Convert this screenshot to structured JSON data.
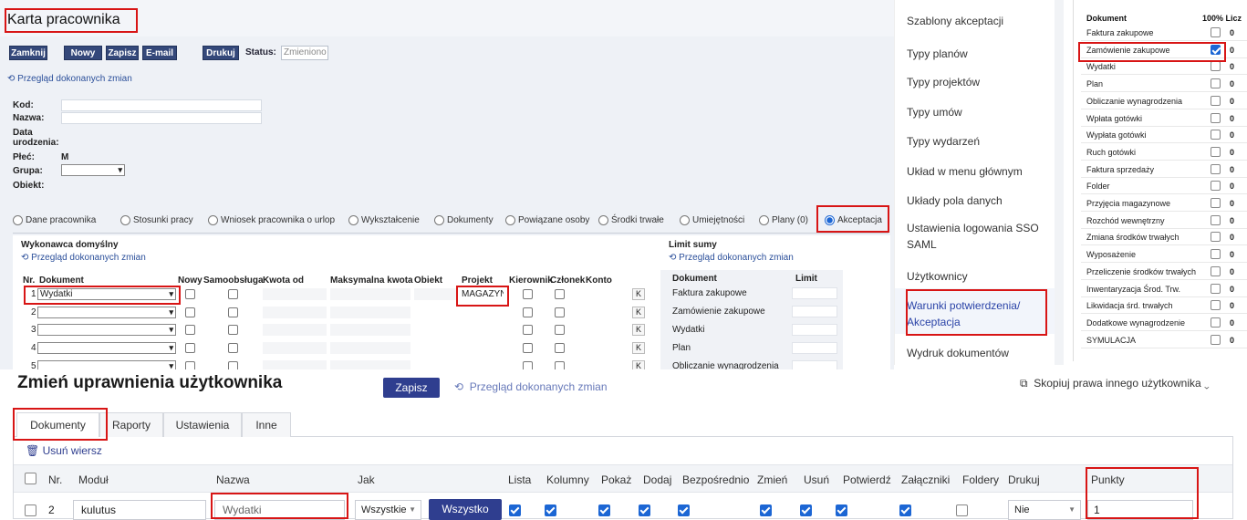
{
  "panel_a": {
    "title": "Karta pracownika",
    "toolbar": {
      "close": "Zamknij",
      "new": "Nowy",
      "save": "Zapisz",
      "email": "E-mail",
      "print": "Drukuj",
      "status_label": "Status:",
      "status_value": "Zmieniono"
    },
    "history_link": "Przegląd dokonanych zmian",
    "fields": {
      "code": "Kod:",
      "name": "Nazwa:",
      "dob_1": "Data",
      "dob_2": "urodzenia:",
      "sex": "Płeć:",
      "sex_value": "M",
      "group": "Grupa:",
      "object": "Obiekt:"
    },
    "tabs": [
      "Dane pracownika",
      "Stosunki pracy",
      "Wniosek pracownika o urlop",
      "Wykształcenie",
      "Dokumenty",
      "Powiązane osoby",
      "Środki trwałe",
      "Umiejętności",
      "Plany (0)",
      "Akceptacja"
    ],
    "section": {
      "title": "Wykonawca domyślny",
      "history_link": "Przegląd dokonanych zmian",
      "columns": [
        "Nr.",
        "Dokument",
        "Nowy",
        "Samoobsługa",
        "Kwota od",
        "Maksymalna kwota",
        "Obiekt",
        "Projekt",
        "Kierownik",
        "Członek",
        "Konto"
      ],
      "rows": [
        {
          "nr": "1",
          "document": "Wydatki",
          "project": "MAGAZYN"
        },
        {
          "nr": "2",
          "document": "",
          "project": ""
        },
        {
          "nr": "3",
          "document": "",
          "project": ""
        },
        {
          "nr": "4",
          "document": "",
          "project": ""
        },
        {
          "nr": "5",
          "document": "",
          "project": ""
        }
      ],
      "k_label": "K"
    },
    "limit": {
      "title": "Limit sumy",
      "history_link": "Przegląd dokonanych zmian",
      "col_document": "Dokument",
      "col_limit": "Limit",
      "rows": [
        "Faktura zakupowe",
        "Zamówienie zakupowe",
        "Wydatki",
        "Plan",
        "Obliczanie wynagrodzenia"
      ]
    }
  },
  "menu": {
    "items": [
      "Szablony akceptacji",
      "Typy planów",
      "Typy projektów",
      "Typy umów",
      "Typy wydarzeń",
      "Układ w menu głównym",
      "Układy pola danych",
      "Ustawienia logowania SSO",
      "SAML",
      "Użytkownicy",
      "Warunki potwierdzenia/",
      "Akceptacja",
      "Wydruk dokumentów"
    ]
  },
  "doc_table": {
    "col_document": "Dokument",
    "col_right": "100% Licz",
    "rows": [
      {
        "label": "Faktura zakupowe",
        "checked": false,
        "value": "0"
      },
      {
        "label": "Zamówienie zakupowe",
        "checked": true,
        "value": "0"
      },
      {
        "label": "Wydatki",
        "checked": false,
        "value": "0"
      },
      {
        "label": "Plan",
        "checked": false,
        "value": "0"
      },
      {
        "label": "Obliczanie wynagrodzenia",
        "checked": false,
        "value": "0"
      },
      {
        "label": "Wpłata gotówki",
        "checked": false,
        "value": "0"
      },
      {
        "label": "Wypłata gotówki",
        "checked": false,
        "value": "0"
      },
      {
        "label": "Ruch gotówki",
        "checked": false,
        "value": "0"
      },
      {
        "label": "Faktura sprzedaży",
        "checked": false,
        "value": "0"
      },
      {
        "label": "Folder",
        "checked": false,
        "value": "0"
      },
      {
        "label": "Przyjęcia magazynowe",
        "checked": false,
        "value": "0"
      },
      {
        "label": "Rozchód wewnętrzny",
        "checked": false,
        "value": "0"
      },
      {
        "label": "Zmiana środków trwałych",
        "checked": false,
        "value": "0"
      },
      {
        "label": "Wyposażenie",
        "checked": false,
        "value": "0"
      },
      {
        "label": "Przeliczenie środków trwałych",
        "checked": false,
        "value": "0"
      },
      {
        "label": "Inwentaryzacja Środ. Trw.",
        "checked": false,
        "value": "0"
      },
      {
        "label": "Likwidacja śrd. trwałych",
        "checked": false,
        "value": "0"
      },
      {
        "label": "Dodatkowe wynagrodzenie",
        "checked": false,
        "value": "0"
      },
      {
        "label": "SYMULACJA",
        "checked": false,
        "value": "0"
      }
    ]
  },
  "rights": {
    "title": "Zmień uprawnienia użytkownika",
    "save": "Zapisz",
    "history_link": "Przegląd dokonanych zmian",
    "copy": "Skopiuj prawa innego użytkownika",
    "tabs": [
      "Dokumenty",
      "Raporty",
      "Ustawienia",
      "Inne"
    ],
    "delete_row": "Usuń wiersz",
    "columns": [
      "Nr.",
      "Moduł",
      "Nazwa",
      "Jak",
      "Lista",
      "Kolumny",
      "Pokaż",
      "Dodaj",
      "Bezpośrednio",
      "Zmień",
      "Usuń",
      "Potwierdź",
      "Załączniki",
      "Foldery",
      "Drukuj",
      "Punkty"
    ],
    "row": {
      "nr": "2",
      "module": "kulutus",
      "name": "Wydatki",
      "how": "Wszystkie",
      "how_button": "Wszystko",
      "print": "Nie",
      "points": "1"
    }
  }
}
